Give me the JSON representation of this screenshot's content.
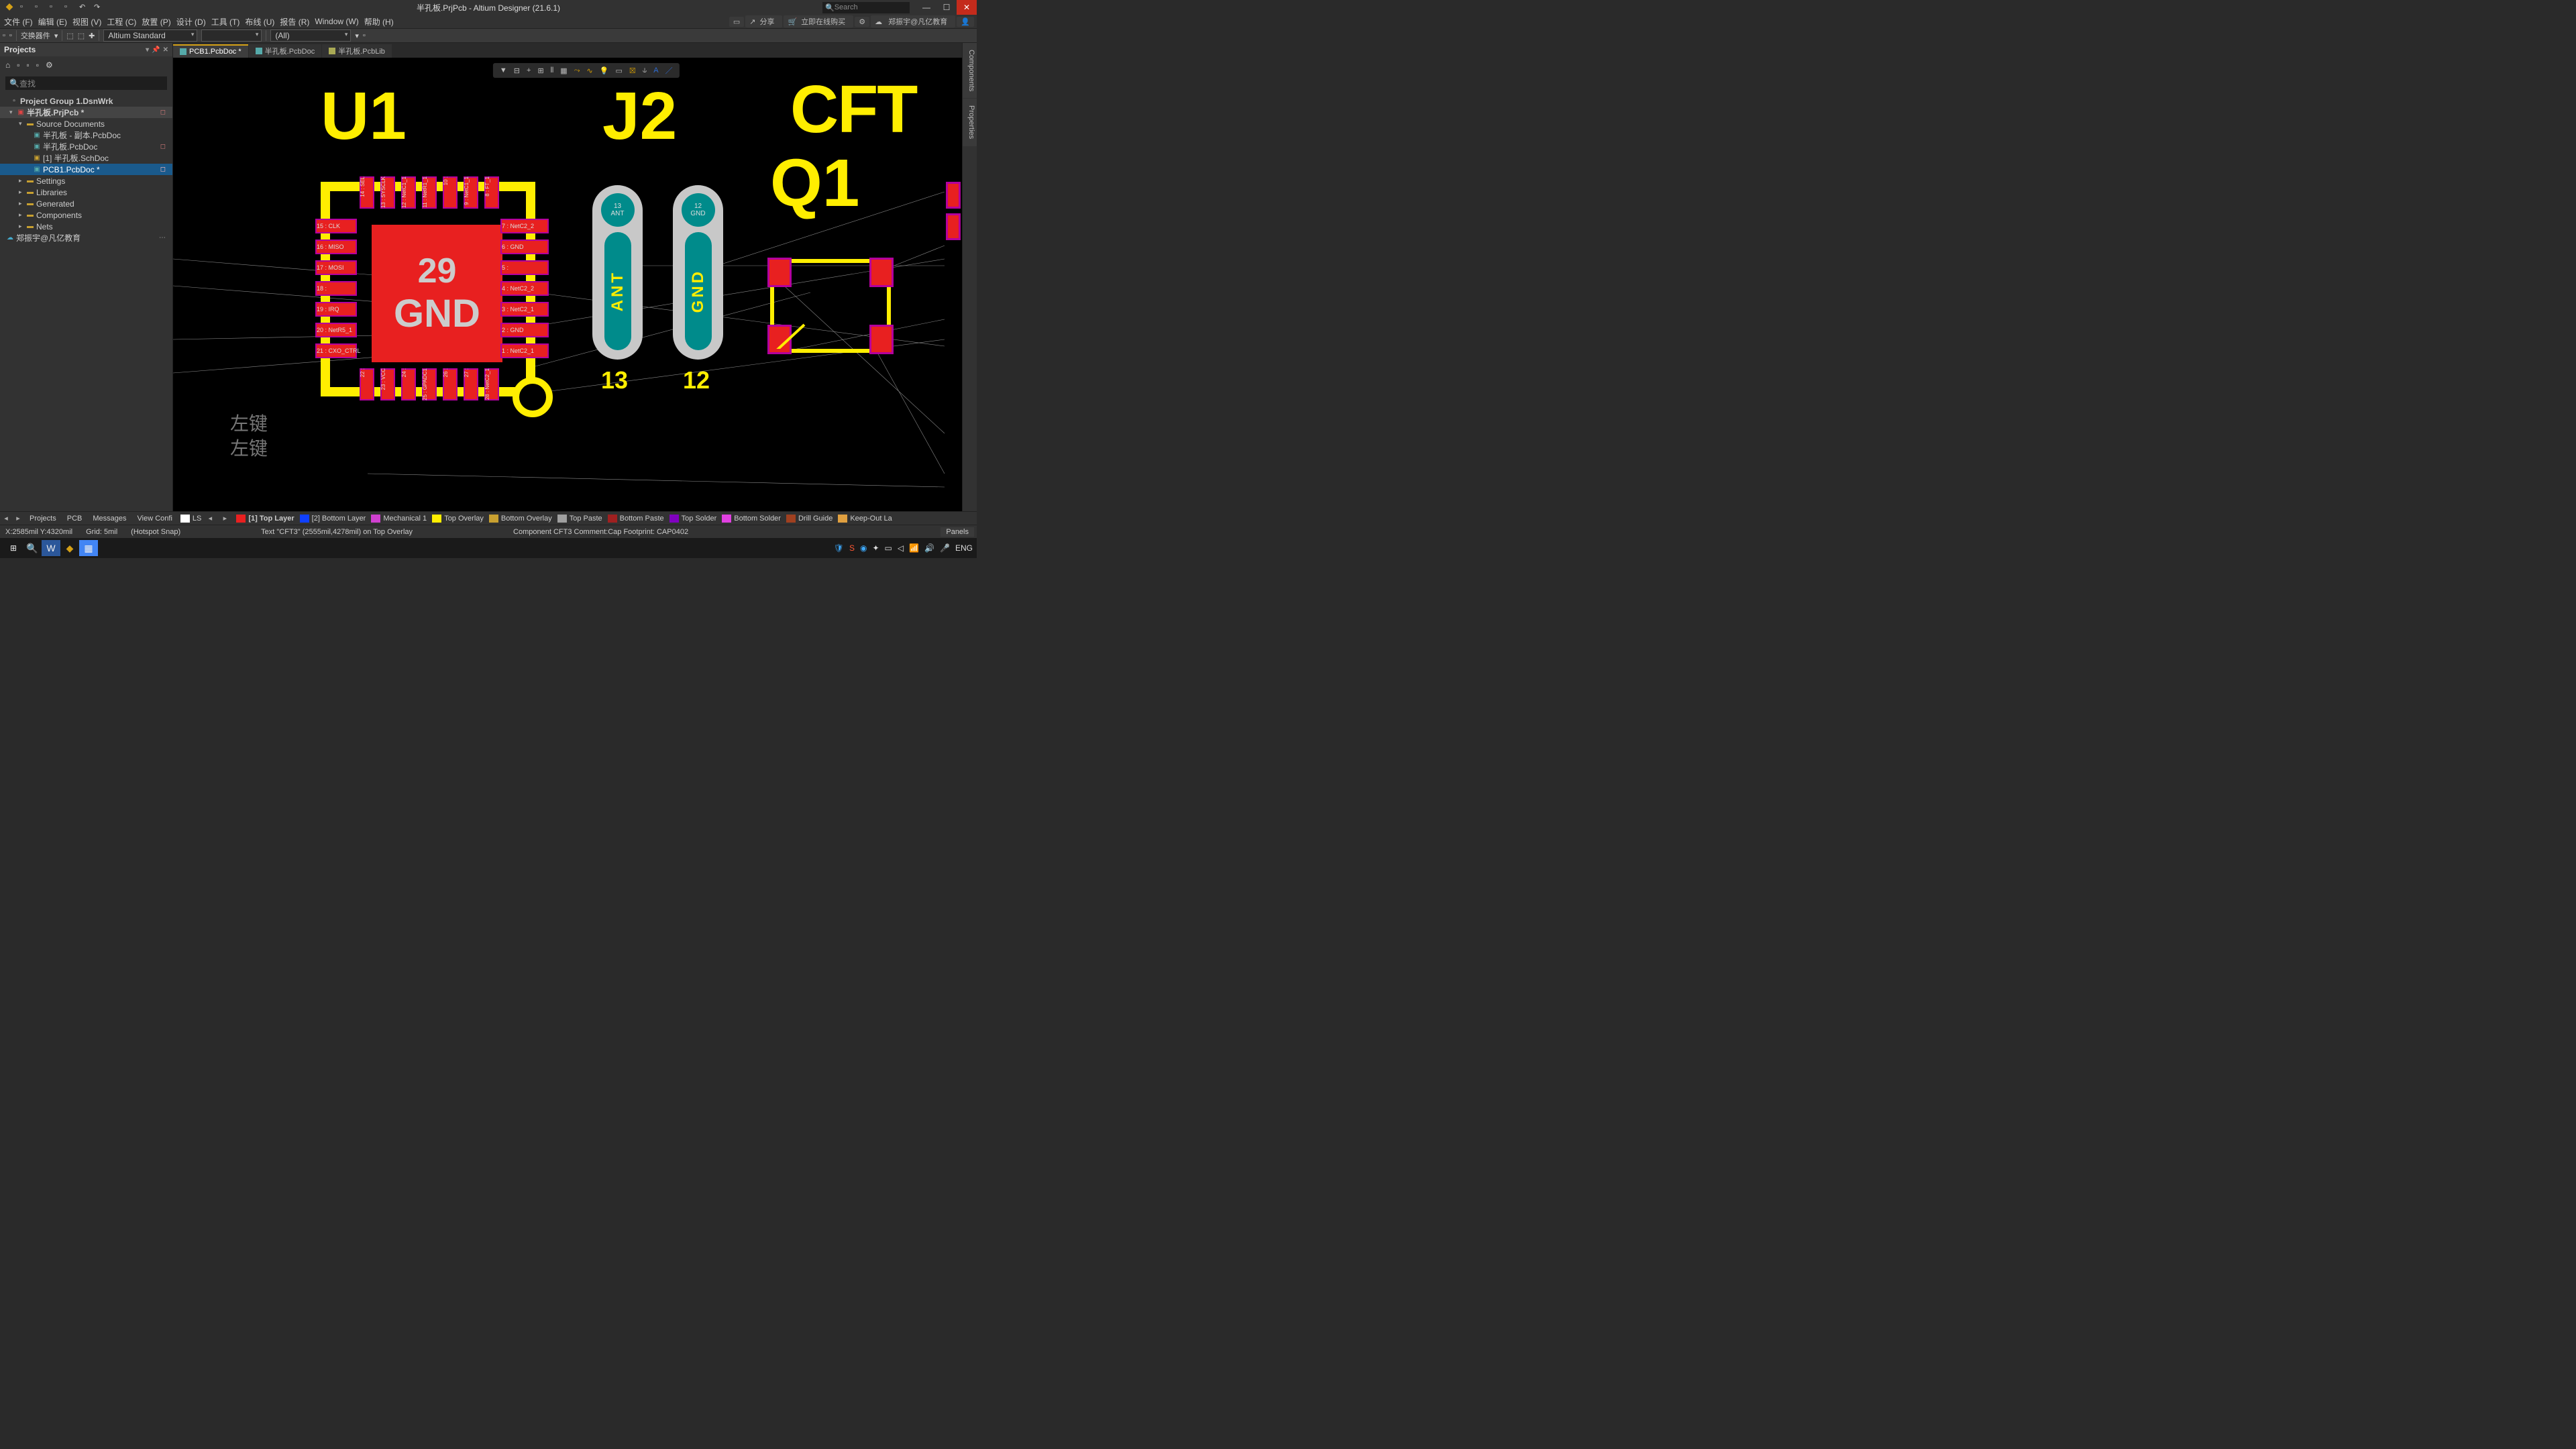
{
  "titlebar": {
    "title": "半孔板.PrjPcb - Altium Designer (21.6.1)",
    "search_placeholder": "Search"
  },
  "menu": {
    "items": [
      "文件 (F)",
      "编辑 (E)",
      "视图 (V)",
      "工程 (C)",
      "放置 (P)",
      "设计 (D)",
      "工具 (T)",
      "布线 (U)",
      "报告 (R)",
      "Window (W)",
      "帮助 (H)"
    ],
    "right": {
      "share": "分享",
      "buy": "立即在线购买",
      "user": "郑振宇@凡亿教育"
    }
  },
  "toolbar": {
    "swap": "交换器件",
    "combo1": "Altium Standard",
    "combo3": "(All)"
  },
  "projects": {
    "title": "Projects",
    "search_placeholder": "查找",
    "tree": {
      "group": "Project Group 1.DsnWrk",
      "prj": "半孔板.PrjPcb *",
      "src": "Source Documents",
      "doc1": "半孔板 - 副本.PcbDoc",
      "doc2": "半孔板.PcbDoc",
      "doc3": "[1] 半孔板.SchDoc",
      "doc4": "PCB1.PcbDoc *",
      "settings": "Settings",
      "libraries": "Libraries",
      "generated": "Generated",
      "components": "Components",
      "nets": "Nets",
      "cloud": "郑振宇@凡亿教育"
    },
    "hint1": "左键",
    "hint2": "左键"
  },
  "tabs": {
    "t1": "PCB1.PcbDoc *",
    "t2": "半孔板.PcbDoc",
    "t3": "半孔板.PcbLib"
  },
  "pcb": {
    "u1": "U1",
    "j2": "J2",
    "cft1": "CFT",
    "q1": "Q1",
    "center_num": "29",
    "center_net": "GND",
    "left_pads": [
      {
        "n": "15",
        "t": "CLK"
      },
      {
        "n": "16",
        "t": "MISO"
      },
      {
        "n": "17",
        "t": "MOSI"
      },
      {
        "n": "18",
        "t": ""
      },
      {
        "n": "19",
        "t": "IRQ"
      },
      {
        "n": "20",
        "t": "NetR5_1"
      },
      {
        "n": "21",
        "t": "CXO_CTRL"
      }
    ],
    "right_pads": [
      {
        "n": "7",
        "t": "NetC2_2"
      },
      {
        "n": "6",
        "t": "GND"
      },
      {
        "n": "5",
        "t": ""
      },
      {
        "n": "4",
        "t": "NetC2_2"
      },
      {
        "n": "3",
        "t": "NetC2_1"
      },
      {
        "n": "2",
        "t": "GND"
      },
      {
        "n": "1",
        "t": "NetC2_1"
      }
    ],
    "top_pads": [
      "14",
      "13",
      "12",
      "11",
      "10",
      "9",
      "8"
    ],
    "top_nets": [
      "SEL",
      "SYSCLK",
      "NetC1_1",
      "NetR1_1",
      "",
      "NetC1_1",
      "FT_1"
    ],
    "bot_pads": [
      "22",
      "23",
      "24",
      "25",
      "26",
      "27",
      "28"
    ],
    "bot_nets": [
      "",
      "VCC",
      "",
      "GPADC1",
      "",
      "",
      "NetC2_1"
    ],
    "via1_n": "13",
    "via1_t": "ANT",
    "via2_n": "12",
    "via2_t": "GND",
    "slot1": "ANT",
    "slot2": "GND",
    "below1": "13",
    "below2": "12"
  },
  "side": {
    "comp": "Components",
    "props": "Properties"
  },
  "bottom_tabs": {
    "left": [
      "Projects",
      "PCB",
      "Messages",
      "View Confi"
    ],
    "ls": "LS",
    "layers": [
      {
        "c": "#e82020",
        "t": "[1] Top Layer",
        "bold": true
      },
      {
        "c": "#1040ff",
        "t": "[2] Bottom Layer"
      },
      {
        "c": "#d040d0",
        "t": "Mechanical 1"
      },
      {
        "c": "#ffee00",
        "t": "Top Overlay"
      },
      {
        "c": "#c8a030",
        "t": "Bottom Overlay"
      },
      {
        "c": "#a0a0a0",
        "t": "Top Paste"
      },
      {
        "c": "#a02020",
        "t": "Bottom Paste"
      },
      {
        "c": "#8000c0",
        "t": "Top Solder"
      },
      {
        "c": "#e040e0",
        "t": "Bottom Solder"
      },
      {
        "c": "#a04020",
        "t": "Drill Guide"
      },
      {
        "c": "#e0a040",
        "t": "Keep-Out La"
      }
    ]
  },
  "status": {
    "coords": "X:2585mil Y:4320mil",
    "grid": "Grid: 5mil",
    "snap": "(Hotspot Snap)",
    "obj": "Text \"CFT3\" (2555mil,4278mil) on Top Overlay",
    "comp": "Component CFT3 Comment:Cap Footprint: CAP0402",
    "panels": "Panels"
  },
  "taskbar": {
    "lang": "ENG"
  }
}
